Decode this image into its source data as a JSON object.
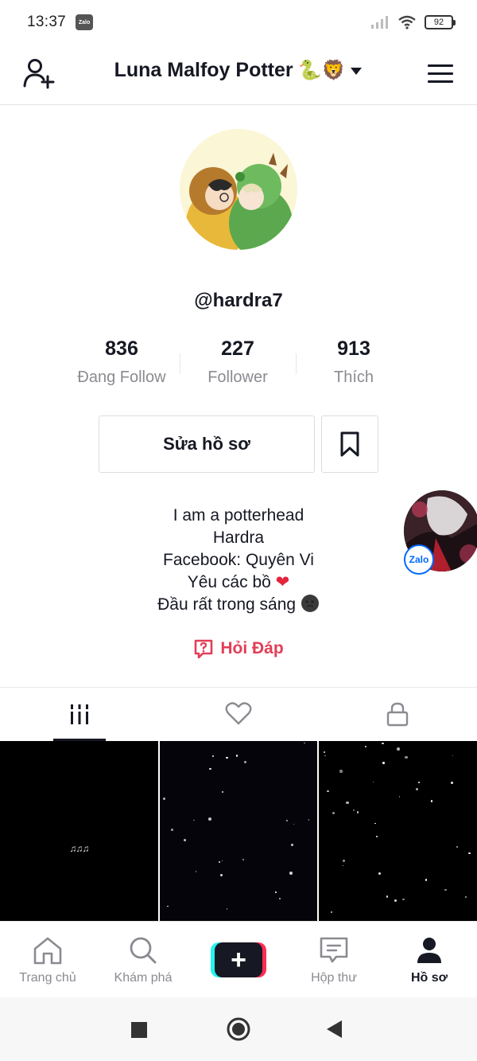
{
  "status_bar": {
    "time": "13:37",
    "notification_app": "Zalo",
    "battery": "92"
  },
  "header": {
    "title": "Luna Malfoy Potter",
    "title_emojis": "🐍🦁",
    "icons": [
      "add-user-icon",
      "chevron-down-icon",
      "menu-icon"
    ]
  },
  "profile": {
    "username": "@hardra7",
    "stats": [
      {
        "count": "836",
        "label": "Đang Follow"
      },
      {
        "count": "227",
        "label": "Follower"
      },
      {
        "count": "913",
        "label": "Thích"
      }
    ],
    "edit_button": "Sửa hồ sơ",
    "bio": [
      "I am a potterhead",
      "Hardra",
      "Facebook: Quyên Vi",
      "Yêu các bồ",
      "Đầu rất trong sáng"
    ],
    "bio_heart": "❤",
    "qa_link": "Hỏi Đáp"
  },
  "floating_bubble": {
    "app": "Zalo"
  },
  "tabs": [
    {
      "name": "videos",
      "icon": "grid-icon",
      "active": true
    },
    {
      "name": "liked",
      "icon": "heart-icon",
      "active": false
    },
    {
      "name": "private",
      "icon": "lock-icon",
      "active": false
    }
  ],
  "videos": [
    {
      "caption": "♫♫♫"
    },
    {
      "caption": ""
    },
    {
      "caption": ""
    }
  ],
  "bottom_nav": [
    {
      "label": "Trang chủ",
      "icon": "home-icon"
    },
    {
      "label": "Khám phá",
      "icon": "search-icon"
    },
    {
      "label": "",
      "icon": "plus-icon"
    },
    {
      "label": "Hộp thư",
      "icon": "inbox-icon"
    },
    {
      "label": "Hồ sơ",
      "icon": "profile-icon",
      "active": true
    }
  ],
  "colors": {
    "accent_red": "#e23e57",
    "text_primary": "#161823",
    "text_secondary": "#8a8b91",
    "create_cyan": "#25f4ee",
    "create_pink": "#fe2c55"
  }
}
